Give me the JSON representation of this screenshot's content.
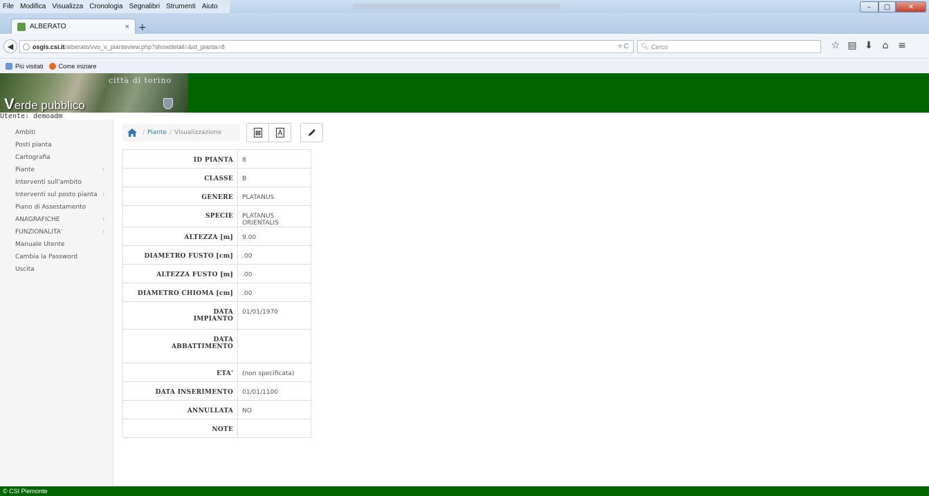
{
  "browser": {
    "menu": [
      "File",
      "Modifica",
      "Visualizza",
      "Cronologia",
      "Segnalibri",
      "Strumenti",
      "Aiuto"
    ],
    "tab_title": "ALBERATO",
    "tab_close": "×",
    "new_tab": "+",
    "url_host": "osgis.csi.it",
    "url_path": "/alberato/vvo_v_pianteview.php?showdetail=&id_pianta=8",
    "search_placeholder": "Cerco",
    "bookmarks": [
      "Più visitati",
      "Come iniziare"
    ]
  },
  "header": {
    "city": "città di torino",
    "title_initial": "V",
    "title_rest": "erde pubblico"
  },
  "user": "Utente: demoadm",
  "sidebar": {
    "items": [
      {
        "label": "Ambiti",
        "arrow": ""
      },
      {
        "label": "Posti pianta",
        "arrow": ""
      },
      {
        "label": "Cartografia",
        "arrow": ""
      },
      {
        "label": "Piante",
        "arrow": "›"
      },
      {
        "label": "Interventi sull'ambito",
        "arrow": ""
      },
      {
        "label": "Interventi sul posto pianta",
        "arrow": "›"
      },
      {
        "label": "Piano di Assestamento",
        "arrow": ""
      },
      {
        "label": "ANAGRAFICHE",
        "arrow": "›"
      },
      {
        "label": "FUNZIONALITA'",
        "arrow": "›"
      },
      {
        "label": "Manuale Utente",
        "arrow": ""
      },
      {
        "label": "Cambia la Password",
        "arrow": ""
      },
      {
        "label": "Uscita",
        "arrow": ""
      }
    ]
  },
  "breadcrumb": {
    "sep": "/",
    "link": "Piante",
    "active": "Visualizzazione"
  },
  "detail": {
    "rows": [
      {
        "label": "ID PIANTA",
        "value": "8"
      },
      {
        "label": "CLASSE",
        "value": "B"
      },
      {
        "label": "GENERE",
        "value": "PLATANUS"
      },
      {
        "label": "SPECIE",
        "value": "PLATANUS ORIENTALIS"
      },
      {
        "label": "ALTEZZA [m]",
        "value": "9.00"
      },
      {
        "label": "DIAMETRO FUSTO [cm]",
        "value": ".00"
      },
      {
        "label": "ALTEZZA FUSTO [m]",
        "value": ".00"
      },
      {
        "label": "DIAMETRO CHIOMA [cm]",
        "value": ".00"
      },
      {
        "label": "DATA IMPIANTO",
        "value": "01/01/1970"
      },
      {
        "label": "DATA ABBATTIMENTO",
        "value": ""
      },
      {
        "label": "ETA'",
        "value": "(non specificata)"
      },
      {
        "label": "DATA INSERIMENTO",
        "value": "01/01/1100"
      },
      {
        "label": "ANNULLATA",
        "value": "NO"
      },
      {
        "label": "NOTE",
        "value": ""
      }
    ]
  },
  "footer": "© CSI Piemonte",
  "colors": {
    "header_green": "#006400",
    "link_blue": "#337ab7"
  }
}
